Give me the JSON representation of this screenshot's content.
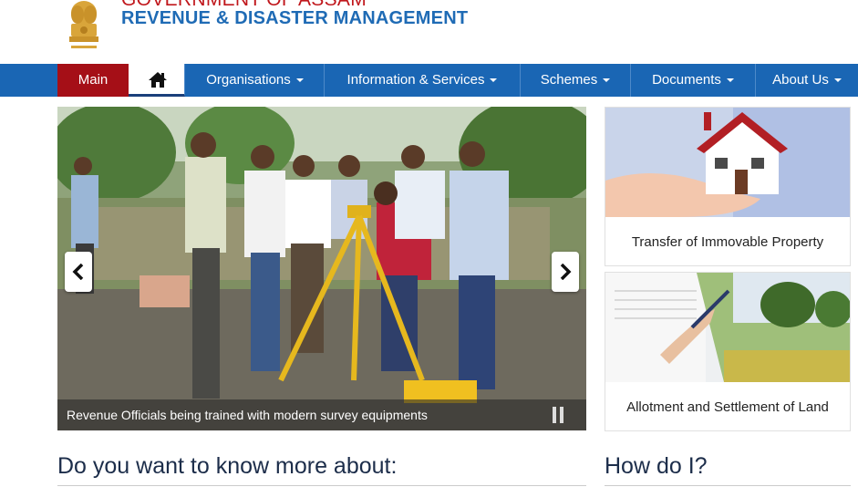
{
  "header": {
    "title_top": "GOVERNMENT OF ASSAM",
    "title_main": "REVENUE & DISASTER MANAGEMENT",
    "emblem_icon": "national-emblem-icon",
    "colors": {
      "brand_red": "#c0171c",
      "brand_blue": "#1f6bb5"
    }
  },
  "nav": {
    "main_label": "Main",
    "home_icon": "home-icon",
    "items": [
      {
        "label": "Organisations"
      },
      {
        "label": "Information & Services"
      },
      {
        "label": "Schemes"
      },
      {
        "label": "Documents"
      },
      {
        "label": "About Us"
      }
    ],
    "colors": {
      "bar": "#1a66b4",
      "active": "#a50f17"
    }
  },
  "carousel": {
    "caption": "Revenue Officials being trained with modern survey equipments",
    "prev_icon": "chevron-left-icon",
    "next_icon": "chevron-right-icon",
    "pause_icon": "pause-icon"
  },
  "cards": [
    {
      "label": "Transfer of Immovable Property"
    },
    {
      "label": "Allotment and Settlement of Land"
    }
  ],
  "sections": {
    "left_heading": "Do you want to know more about:",
    "right_heading": "How do I?"
  }
}
